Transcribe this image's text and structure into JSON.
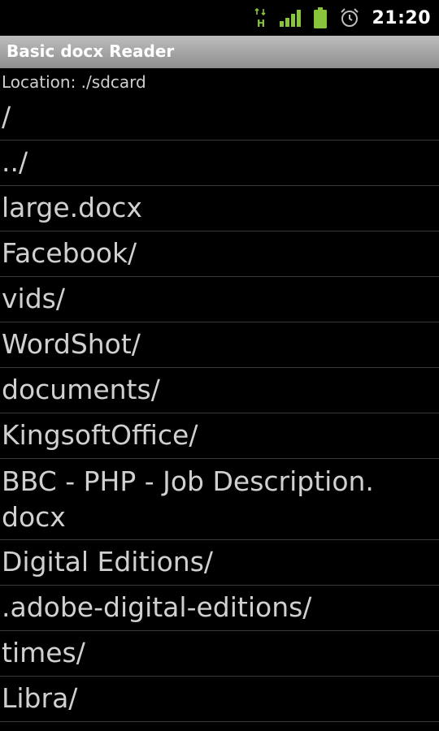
{
  "status_bar": {
    "network_label": "H",
    "clock": "21:20",
    "icons": [
      "hspa-data-icon",
      "signal-strength-icon",
      "battery-icon",
      "alarm-clock-icon"
    ],
    "accent_color": "#8ac43a"
  },
  "app": {
    "title": "Basic docx Reader",
    "location": "Location: ./sdcard"
  },
  "files": [
    {
      "name": "/"
    },
    {
      "name": "../"
    },
    {
      "name": "large.docx"
    },
    {
      "name": "Facebook/"
    },
    {
      "name": "vids/"
    },
    {
      "name": "WordShot/"
    },
    {
      "name": "documents/"
    },
    {
      "name": "KingsoftOffice/"
    },
    {
      "name": "BBC - PHP - Job Description.\ndocx"
    },
    {
      "name": "Digital Editions/"
    },
    {
      "name": ".adobe-digital-editions/"
    },
    {
      "name": "times/"
    },
    {
      "name": "Libra/"
    }
  ]
}
